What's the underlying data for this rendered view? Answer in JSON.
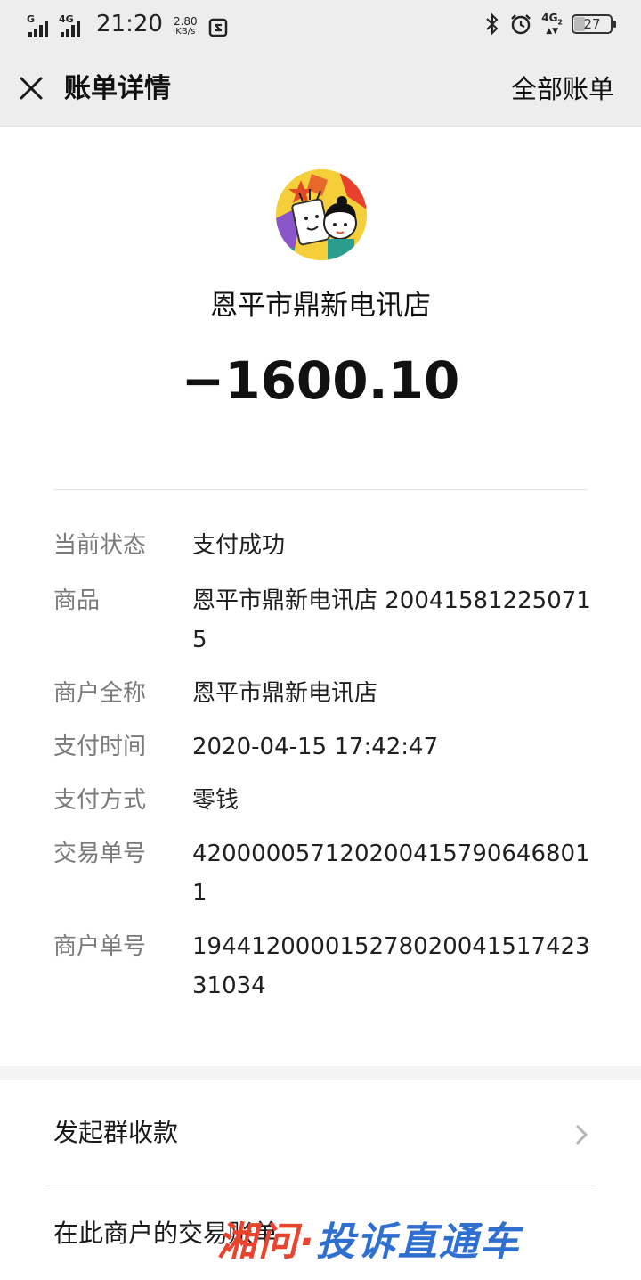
{
  "status_bar": {
    "sim1_label": "G",
    "sim2_label": "4G",
    "time": "21:20",
    "net_speed_value": "2.80",
    "net_speed_unit": "KB/s",
    "net_type": "4G",
    "net_sub": "2",
    "battery": "27",
    "icons": [
      "signal-icon",
      "signal-icon",
      "screenshot-icon",
      "bluetooth-icon",
      "alarm-icon",
      "battery-icon"
    ]
  },
  "nav": {
    "title": "账单详情",
    "right_link": "全部账单",
    "close_icon": "close-icon"
  },
  "header": {
    "merchant_name": "恩平市鼎新电讯店",
    "amount": "−1600.10"
  },
  "details": [
    {
      "label": "当前状态",
      "value": "支付成功"
    },
    {
      "label": "商品",
      "value": "恩平市鼎新电讯店 200415812250715"
    },
    {
      "label": "商户全称",
      "value": "恩平市鼎新电讯店"
    },
    {
      "label": "支付时间",
      "value": "2020-04-15 17:42:47"
    },
    {
      "label": "支付方式",
      "value": "零钱"
    },
    {
      "label": "交易单号",
      "value": "420000057120200415790646801 1"
    },
    {
      "label": "商户单号",
      "value": "194412000015278020041517423 31034"
    }
  ],
  "actions": [
    {
      "label": "发起群收款",
      "icon": "chevron-right-icon"
    },
    {
      "label": "在此商户的交易账单"
    }
  ],
  "watermark": {
    "part1": "湘问·",
    "part2": "投诉直通车"
  },
  "colors": {
    "nav_bg": "#ededed",
    "label_gray": "#7a7a7a",
    "watermark_red": "#e8442e",
    "watermark_blue": "#2f6fcf"
  }
}
